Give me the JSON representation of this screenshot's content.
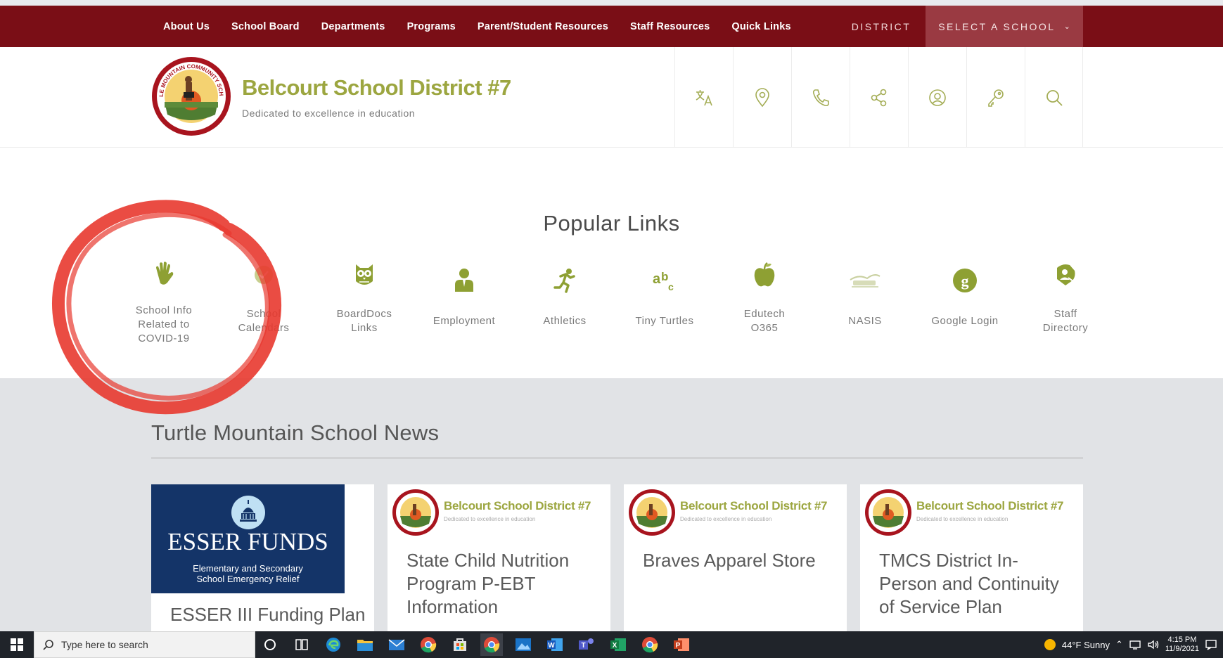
{
  "nav": {
    "menu": [
      "About Us",
      "School Board",
      "Departments",
      "Programs",
      "Parent/Student Resources",
      "Staff Resources",
      "Quick Links"
    ],
    "district_label": "DISTRICT",
    "select_school_label": "SELECT A SCHOOL"
  },
  "header": {
    "title": "Belcourt School District #7",
    "tagline": "Dedicated to excellence in education",
    "logo_text": "TURTLE MOUNTAIN COMMUNITY SCHOOLS",
    "icons": [
      "translate-icon",
      "location-pin-icon",
      "phone-icon",
      "share-icon",
      "user-account-icon",
      "key-icon",
      "search-icon"
    ]
  },
  "popular": {
    "title": "Popular Links",
    "links": [
      {
        "lines": [
          "School Info",
          "Related to",
          "COVID-19"
        ],
        "icon": "hand-icon"
      },
      {
        "lines": [
          "School",
          "Calendars"
        ],
        "icon": "calendar-icon"
      },
      {
        "lines": [
          "BoardDocs",
          "Links"
        ],
        "icon": "owl-icon"
      },
      {
        "lines": [
          "Employment"
        ],
        "icon": "person-icon"
      },
      {
        "lines": [
          "Athletics"
        ],
        "icon": "runner-icon"
      },
      {
        "lines": [
          "Tiny Turtles"
        ],
        "icon": "abc-icon"
      },
      {
        "lines": [
          "Edutech",
          "O365"
        ],
        "icon": "apple-icon"
      },
      {
        "lines": [
          "NASIS"
        ],
        "icon": "nasis-logo-icon"
      },
      {
        "lines": [
          "Google Login"
        ],
        "icon": "google-icon"
      },
      {
        "lines": [
          "Staff",
          "Directory"
        ],
        "icon": "staff-directory-icon"
      }
    ]
  },
  "news": {
    "title": "Turtle Mountain School News",
    "cards": [
      {
        "headline_lines": [
          "ESSER III Funding Plan"
        ],
        "banner_title": "ESSER FUNDS",
        "banner_sub_lines": [
          "Elementary and Secondary",
          "School Emergency Relief"
        ]
      },
      {
        "headline_lines": [
          "State Child Nutrition",
          "Program P-EBT",
          "Information"
        ],
        "mini_title": "Belcourt School District #7",
        "mini_tag": "Dedicated to excellence in education"
      },
      {
        "headline_lines": [
          "Braves Apparel Store"
        ],
        "mini_title": "Belcourt School District #7",
        "mini_tag": "Dedicated to excellence in education"
      },
      {
        "headline_lines": [
          "TMCS District In-",
          "Person and Continuity",
          "of Service Plan"
        ],
        "mini_title": "Belcourt School District #7",
        "mini_tag": "Dedicated to excellence in education"
      }
    ]
  },
  "taskbar": {
    "search_placeholder": "Type here to search",
    "weather": "44°F  Sunny",
    "time": "4:15 PM",
    "date": "11/9/2021"
  },
  "colors": {
    "nav_bg": "#7a0e16",
    "select_school_bg": "#9a3a42",
    "accent_olive": "#9ca640",
    "news_bg": "#e1e3e6",
    "marker_red": "#e8392f"
  }
}
